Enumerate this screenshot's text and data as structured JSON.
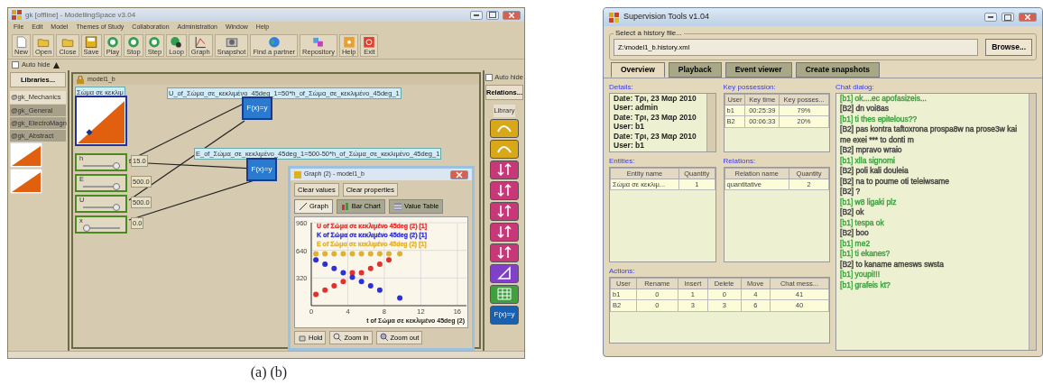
{
  "modelling_window": {
    "title": "gk [offline] - ModellingSpace v3.04",
    "menu": [
      "File",
      "Edit",
      "Model",
      "Themes of Study",
      "Collaboration",
      "Administration",
      "Window",
      "Help"
    ],
    "toolbar": [
      {
        "label": "New",
        "kind": "new"
      },
      {
        "label": "Open",
        "kind": "folder"
      },
      {
        "label": "Close",
        "kind": "folder"
      },
      {
        "label": "Save",
        "kind": "save"
      },
      {
        "label": "Play",
        "kind": "play"
      },
      {
        "label": "Stop",
        "kind": "play"
      },
      {
        "label": "Step",
        "kind": "play"
      },
      {
        "label": "Loop",
        "kind": "loop"
      },
      {
        "label": "Graph",
        "kind": "graph"
      },
      {
        "label": "Snapshot",
        "kind": "snapshot"
      },
      {
        "label": "Find a partner",
        "kind": "globe"
      },
      {
        "label": "Repository",
        "kind": "repository"
      },
      {
        "label": "Help",
        "kind": "help"
      },
      {
        "label": "Exit",
        "kind": "exit"
      }
    ],
    "auto_hide_left": {
      "label": "Auto hide",
      "checked": false
    },
    "libraries_button": "Libraries...",
    "libraries": [
      {
        "label": "@gk_Mechanics",
        "selected": true
      },
      {
        "label": "@gk_General",
        "selected": false
      },
      {
        "label": "@gk_ElectroMagn",
        "selected": false
      },
      {
        "label": "@gk_Abstract",
        "selected": false
      }
    ],
    "model_window": {
      "title": "model1_b",
      "entity_label": "Σώμα σε κεκλιμ",
      "formulas": [
        "U_of_Σώμα_σε_κεκλιμένο_45deg_1=50*h_of_Σώμα_σε_κεκλιμένο_45deg_1",
        "E_of_Σώμα_σε_κεκλιμένο_45deg_1=500-50*h_of_Σώμα_σε_κεκλιμένο_45deg_1"
      ],
      "function_nodes": [
        "F(x)=y",
        "F(x)=y"
      ],
      "sliders": [
        {
          "label": "h",
          "value": "15.0",
          "level": 0.9
        },
        {
          "label": "E",
          "value": "500.0",
          "level": 0.9
        },
        {
          "label": "U",
          "value": "500.0",
          "level": 0.9
        },
        {
          "label": "x",
          "value": "0.0",
          "level": 0.1
        }
      ]
    },
    "graph_window": {
      "title": "Graph (2) - model1_b",
      "buttons": [
        "Clear values",
        "Clear properties"
      ],
      "tabs": [
        {
          "label": "Graph",
          "selected": true
        },
        {
          "label": "Bar Chart",
          "selected": false
        },
        {
          "label": "Value Table",
          "selected": false
        }
      ],
      "chart_data": {
        "type": "scatter",
        "xlabel": "t of Σώμα σε κεκλιμένο 45deg (2)",
        "x": [
          0.5,
          1.5,
          2.5,
          3.5,
          4.5,
          5.5,
          6.5,
          7.5,
          8.5,
          9.7
        ],
        "series": [
          {
            "name": "U of Σώμα σε κεκλιμένο 45deg (2) [1]",
            "color": "#e03030",
            "values": [
              130,
              180,
              230,
              280,
              380,
              380,
              430,
              480,
              530,
              null
            ]
          },
          {
            "name": "K of Σώμα σε κεκλιμένο 45deg (2) [1]",
            "color": "#3030d0",
            "values": [
              530,
              480,
              430,
              380,
              330,
              280,
              230,
              180,
              null,
              90
            ]
          },
          {
            "name": "E of Σώμα σε κεκλιμένο 45deg (2) [1]",
            "color": "#e0b030",
            "values": [
              600,
              600,
              600,
              600,
              600,
              600,
              600,
              600,
              600,
              600
            ]
          }
        ],
        "xlim": [
          0,
          17
        ],
        "ylim": [
          0,
          960
        ],
        "xticks": [
          0,
          4,
          8,
          12,
          16
        ],
        "yticks": [
          320,
          640,
          960
        ],
        "grid": true
      },
      "bottom_buttons": [
        {
          "label": "Hold",
          "kind": "hold"
        },
        {
          "label": "Zoom in",
          "kind": "zoom_in"
        },
        {
          "label": "Zoom out",
          "kind": "zoom_out"
        }
      ]
    },
    "auto_hide_right": {
      "label": "Auto hide",
      "checked": false
    },
    "relations_button": "Relations...",
    "library_tab": "Library",
    "relation_tools": [
      {
        "kind": "curve"
      },
      {
        "kind": "curve"
      },
      {
        "kind": "arrows"
      },
      {
        "kind": "arrows"
      },
      {
        "kind": "arrows"
      },
      {
        "kind": "arrows"
      },
      {
        "kind": "arrows"
      },
      {
        "kind": "triangle"
      },
      {
        "kind": "table"
      },
      {
        "kind": "function",
        "label": "F(x)=y"
      }
    ]
  },
  "caption": "(a) (b)",
  "supervision_window": {
    "title": "Supervision Tools v1.04",
    "file_group": "Select a history file...",
    "file_path": "Z:\\model1_b.history.xml",
    "browse_button": "Browse...",
    "tabs": [
      {
        "label": "Overview",
        "selected": true
      },
      {
        "label": "Playback",
        "selected": false
      },
      {
        "label": "Event viewer",
        "selected": false
      },
      {
        "label": "Create snapshots",
        "selected": false
      }
    ],
    "details": {
      "heading": "Details:",
      "lines": [
        "Date: Τρι, 23 Μαρ 2010",
        "User: admin",
        "Date: Τρι, 23 Μαρ 2010",
        "User: b1",
        "Date: Τρι, 23 Μαρ 2010",
        "User: b1"
      ]
    },
    "key_possession": {
      "heading": "Key possession:",
      "columns": [
        "User",
        "Key time",
        "Key posses..."
      ],
      "rows": [
        [
          "b1",
          "00:25:39",
          "79%"
        ],
        [
          "B2",
          "00:06:33",
          "20%"
        ]
      ]
    },
    "entities": {
      "heading": "Entities:",
      "columns": [
        "Entity name",
        "Quantity"
      ],
      "rows": [
        [
          "Σώμα σε κεκλιμ...",
          "1"
        ]
      ]
    },
    "relations": {
      "heading": "Relations:",
      "columns": [
        "Relation name",
        "Quantity"
      ],
      "rows": [
        [
          "quantitative",
          "2"
        ]
      ]
    },
    "actions": {
      "heading": "Actions:",
      "columns": [
        "User",
        "Rename",
        "Insert",
        "Delete",
        "Move",
        "Chat mess..."
      ],
      "rows": [
        [
          "b1",
          "0",
          "1",
          "0",
          "4",
          "41"
        ],
        [
          "B2",
          "0",
          "3",
          "3",
          "6",
          "40"
        ]
      ]
    },
    "chat": {
      "heading": "Chat dialog:",
      "lines": [
        {
          "text": "[b1] ok....ec apofasizeis...",
          "color": "#40a040"
        },
        {
          "text": "[B2] dn voi8as",
          "color": "#404040"
        },
        {
          "text": "[b1] ti thes epitelous??",
          "color": "#40a040"
        },
        {
          "text": "[B2] pas kontra taftoxrona prospa8w na prose3w kai me exei *** to donti m",
          "color": "#404040"
        },
        {
          "text": "[B2] mpravo wraio",
          "color": "#404040"
        },
        {
          "text": "[b1] xlla signomi",
          "color": "#40a040"
        },
        {
          "text": "[B2] poli kali douleia",
          "color": "#404040"
        },
        {
          "text": "[B2] na to poume oti teleiwsame",
          "color": "#404040"
        },
        {
          "text": "[B2] ?",
          "color": "#404040"
        },
        {
          "text": "[b1] w8 ligaki plz",
          "color": "#40a040"
        },
        {
          "text": "[B2] ok",
          "color": "#404040"
        },
        {
          "text": "[b1] tespa ok",
          "color": "#40a040"
        },
        {
          "text": "[B2] boo",
          "color": "#404040"
        },
        {
          "text": "[b1] me2",
          "color": "#40a040"
        },
        {
          "text": "[b1] ti ekanes?",
          "color": "#40a040"
        },
        {
          "text": "[B2] to kaname amesws swsta",
          "color": "#404040"
        },
        {
          "text": "[b1] youpi!!!",
          "color": "#40a040"
        },
        {
          "text": "[b1] grafeis kt?",
          "color": "#40a040"
        }
      ]
    }
  }
}
